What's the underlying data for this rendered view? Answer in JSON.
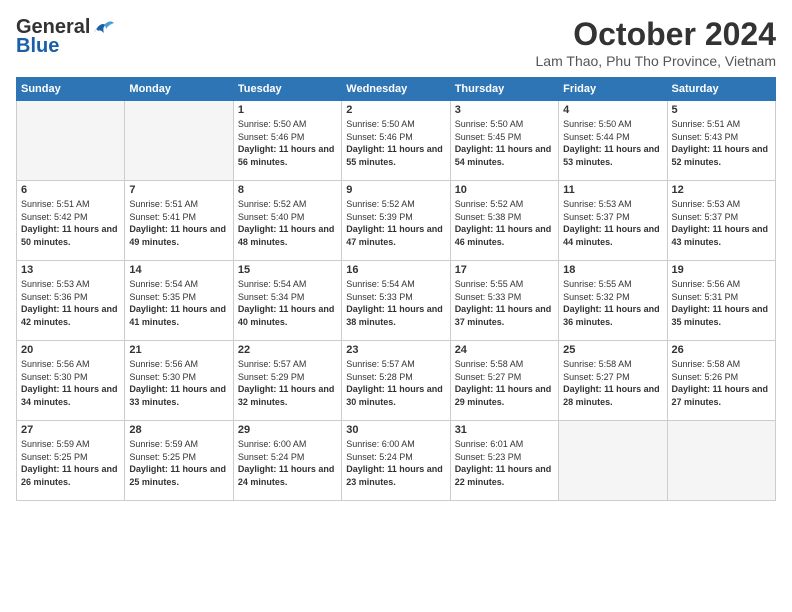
{
  "logo": {
    "general": "General",
    "blue": "Blue"
  },
  "title": "October 2024",
  "subtitle": "Lam Thao, Phu Tho Province, Vietnam",
  "headers": [
    "Sunday",
    "Monday",
    "Tuesday",
    "Wednesday",
    "Thursday",
    "Friday",
    "Saturday"
  ],
  "weeks": [
    [
      {
        "day": "",
        "info": ""
      },
      {
        "day": "",
        "info": ""
      },
      {
        "day": "1",
        "info": "Sunrise: 5:50 AM\nSunset: 5:46 PM\nDaylight: 11 hours and 56 minutes."
      },
      {
        "day": "2",
        "info": "Sunrise: 5:50 AM\nSunset: 5:46 PM\nDaylight: 11 hours and 55 minutes."
      },
      {
        "day": "3",
        "info": "Sunrise: 5:50 AM\nSunset: 5:45 PM\nDaylight: 11 hours and 54 minutes."
      },
      {
        "day": "4",
        "info": "Sunrise: 5:50 AM\nSunset: 5:44 PM\nDaylight: 11 hours and 53 minutes."
      },
      {
        "day": "5",
        "info": "Sunrise: 5:51 AM\nSunset: 5:43 PM\nDaylight: 11 hours and 52 minutes."
      }
    ],
    [
      {
        "day": "6",
        "info": "Sunrise: 5:51 AM\nSunset: 5:42 PM\nDaylight: 11 hours and 50 minutes."
      },
      {
        "day": "7",
        "info": "Sunrise: 5:51 AM\nSunset: 5:41 PM\nDaylight: 11 hours and 49 minutes."
      },
      {
        "day": "8",
        "info": "Sunrise: 5:52 AM\nSunset: 5:40 PM\nDaylight: 11 hours and 48 minutes."
      },
      {
        "day": "9",
        "info": "Sunrise: 5:52 AM\nSunset: 5:39 PM\nDaylight: 11 hours and 47 minutes."
      },
      {
        "day": "10",
        "info": "Sunrise: 5:52 AM\nSunset: 5:38 PM\nDaylight: 11 hours and 46 minutes."
      },
      {
        "day": "11",
        "info": "Sunrise: 5:53 AM\nSunset: 5:37 PM\nDaylight: 11 hours and 44 minutes."
      },
      {
        "day": "12",
        "info": "Sunrise: 5:53 AM\nSunset: 5:37 PM\nDaylight: 11 hours and 43 minutes."
      }
    ],
    [
      {
        "day": "13",
        "info": "Sunrise: 5:53 AM\nSunset: 5:36 PM\nDaylight: 11 hours and 42 minutes."
      },
      {
        "day": "14",
        "info": "Sunrise: 5:54 AM\nSunset: 5:35 PM\nDaylight: 11 hours and 41 minutes."
      },
      {
        "day": "15",
        "info": "Sunrise: 5:54 AM\nSunset: 5:34 PM\nDaylight: 11 hours and 40 minutes."
      },
      {
        "day": "16",
        "info": "Sunrise: 5:54 AM\nSunset: 5:33 PM\nDaylight: 11 hours and 38 minutes."
      },
      {
        "day": "17",
        "info": "Sunrise: 5:55 AM\nSunset: 5:33 PM\nDaylight: 11 hours and 37 minutes."
      },
      {
        "day": "18",
        "info": "Sunrise: 5:55 AM\nSunset: 5:32 PM\nDaylight: 11 hours and 36 minutes."
      },
      {
        "day": "19",
        "info": "Sunrise: 5:56 AM\nSunset: 5:31 PM\nDaylight: 11 hours and 35 minutes."
      }
    ],
    [
      {
        "day": "20",
        "info": "Sunrise: 5:56 AM\nSunset: 5:30 PM\nDaylight: 11 hours and 34 minutes."
      },
      {
        "day": "21",
        "info": "Sunrise: 5:56 AM\nSunset: 5:30 PM\nDaylight: 11 hours and 33 minutes."
      },
      {
        "day": "22",
        "info": "Sunrise: 5:57 AM\nSunset: 5:29 PM\nDaylight: 11 hours and 32 minutes."
      },
      {
        "day": "23",
        "info": "Sunrise: 5:57 AM\nSunset: 5:28 PM\nDaylight: 11 hours and 30 minutes."
      },
      {
        "day": "24",
        "info": "Sunrise: 5:58 AM\nSunset: 5:27 PM\nDaylight: 11 hours and 29 minutes."
      },
      {
        "day": "25",
        "info": "Sunrise: 5:58 AM\nSunset: 5:27 PM\nDaylight: 11 hours and 28 minutes."
      },
      {
        "day": "26",
        "info": "Sunrise: 5:58 AM\nSunset: 5:26 PM\nDaylight: 11 hours and 27 minutes."
      }
    ],
    [
      {
        "day": "27",
        "info": "Sunrise: 5:59 AM\nSunset: 5:25 PM\nDaylight: 11 hours and 26 minutes."
      },
      {
        "day": "28",
        "info": "Sunrise: 5:59 AM\nSunset: 5:25 PM\nDaylight: 11 hours and 25 minutes."
      },
      {
        "day": "29",
        "info": "Sunrise: 6:00 AM\nSunset: 5:24 PM\nDaylight: 11 hours and 24 minutes."
      },
      {
        "day": "30",
        "info": "Sunrise: 6:00 AM\nSunset: 5:24 PM\nDaylight: 11 hours and 23 minutes."
      },
      {
        "day": "31",
        "info": "Sunrise: 6:01 AM\nSunset: 5:23 PM\nDaylight: 11 hours and 22 minutes."
      },
      {
        "day": "",
        "info": ""
      },
      {
        "day": "",
        "info": ""
      }
    ]
  ]
}
